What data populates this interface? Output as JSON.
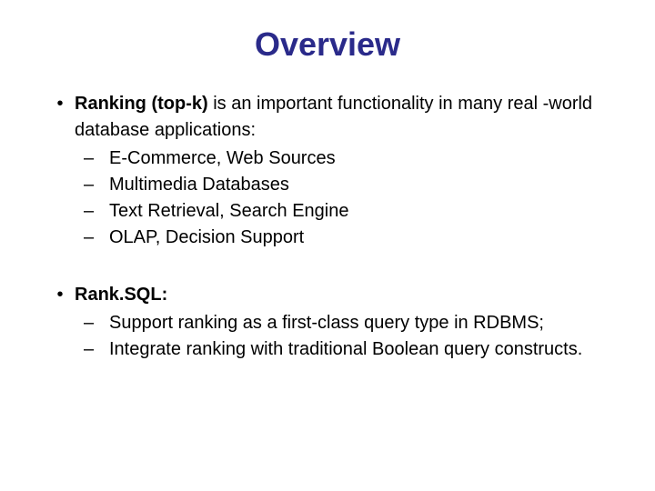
{
  "title": "Overview",
  "b1_bold": "Ranking (top-k)",
  "b1_rest": " is an important functionality in many real -world database applications:",
  "b1_sub1": "E-Commerce, Web Sources",
  "b1_sub2": "Multimedia Databases",
  "b1_sub3": "Text Retrieval, Search Engine",
  "b1_sub4": "OLAP, Decision Support",
  "b2_bold": "Rank.SQL:",
  "b2_sub1": "Support ranking as a first-class query type in RDBMS;",
  "b2_sub2": "Integrate ranking with traditional Boolean query constructs.",
  "dot": "•",
  "dash": "–"
}
